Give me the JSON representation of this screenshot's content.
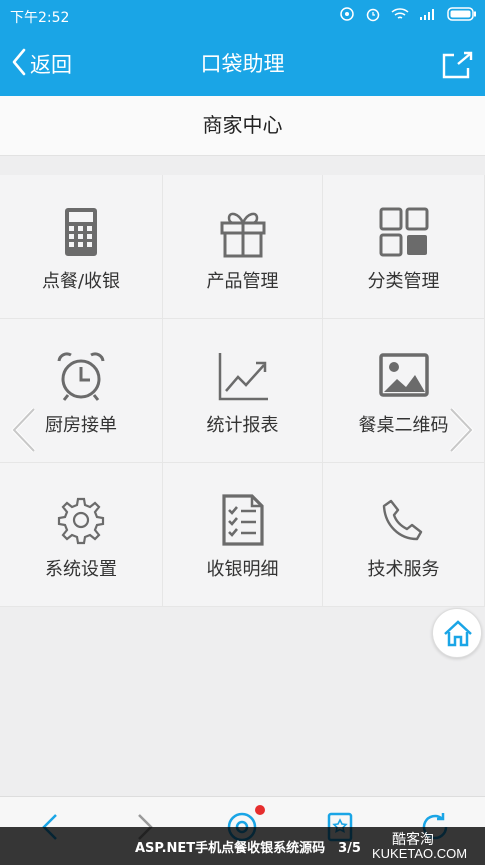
{
  "status_bar": {
    "time": "下午2:52",
    "icons": [
      "sync-icon",
      "alarm-icon",
      "wifi-icon",
      "signal-icon",
      "battery-icon"
    ]
  },
  "title_bar": {
    "back_label": "返回",
    "title": "口袋助理",
    "share_icon": "share-icon"
  },
  "section": {
    "title": "商家中心"
  },
  "grid": {
    "items": [
      {
        "label": "点餐/收银",
        "icon": "calculator-icon"
      },
      {
        "label": "产品管理",
        "icon": "gift-icon"
      },
      {
        "label": "分类管理",
        "icon": "grid-icon"
      },
      {
        "label": "厨房接单",
        "icon": "alarm-clock-icon"
      },
      {
        "label": "统计报表",
        "icon": "trend-chart-icon"
      },
      {
        "label": "餐桌二维码",
        "icon": "image-icon"
      },
      {
        "label": "系统设置",
        "icon": "gear-icon"
      },
      {
        "label": "收银明细",
        "icon": "checklist-icon"
      },
      {
        "label": "技术服务",
        "icon": "phone-icon"
      }
    ]
  },
  "bottom_nav": {
    "icons": [
      "back-arrow-icon",
      "forward-arrow-icon",
      "message-icon",
      "bookmark-icon",
      "refresh-icon"
    ]
  },
  "watermark": {
    "caption": "ASP.NET手机点餐收银系统源码　3/5",
    "brand": "酷客淘",
    "site": "KUKETAO.COM"
  },
  "colors": {
    "accent": "#1aa5e6",
    "icon_gray": "#6b6b6b",
    "badge": "#e62e2e"
  }
}
